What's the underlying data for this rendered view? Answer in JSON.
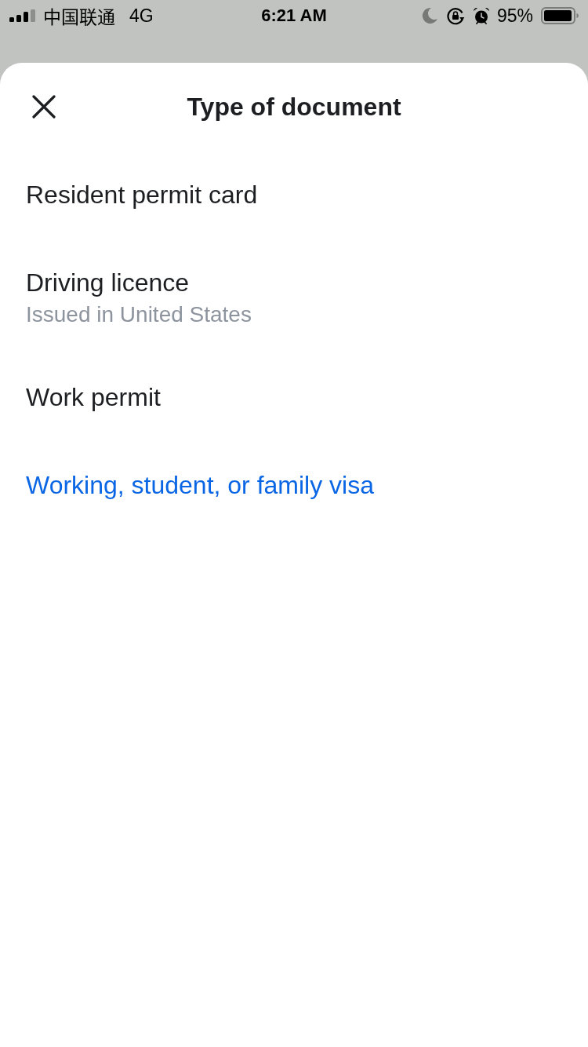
{
  "status_bar": {
    "carrier": "中国联通",
    "network": "4G",
    "time": "6:21 AM",
    "battery": "95%"
  },
  "sheet": {
    "title": "Type of document",
    "items": [
      {
        "kind": "option",
        "label": "Resident permit card"
      },
      {
        "kind": "option",
        "label": "Driving licence",
        "sublabel": "Issued in United States"
      },
      {
        "kind": "option",
        "label": "Work permit"
      },
      {
        "kind": "link",
        "label": "Working, student, or family visa"
      }
    ]
  }
}
